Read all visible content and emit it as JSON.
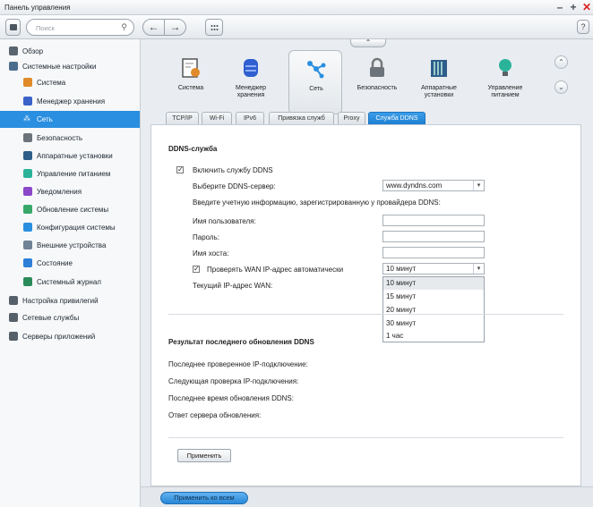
{
  "window": {
    "title": "Панель управления"
  },
  "toolbar": {
    "search_placeholder": "Поиск",
    "help_label": "?"
  },
  "sidebar": {
    "items": [
      {
        "label": "Обзор",
        "level": "top",
        "icon": "overview-icon",
        "color": "#5b6570"
      },
      {
        "label": "Системные настройки",
        "level": "top",
        "icon": "gear-icon",
        "color": "#4c6e8c"
      },
      {
        "label": "Система",
        "level": "sub",
        "icon": "system-icon",
        "color": "#e08a2a"
      },
      {
        "label": "Менеджер хранения",
        "level": "sub",
        "icon": "storage-icon",
        "color": "#3a62c8"
      },
      {
        "label": "Сеть",
        "level": "sub",
        "icon": "network-icon",
        "color": "#ffffff",
        "selected": true
      },
      {
        "label": "Безопасность",
        "level": "sub",
        "icon": "lock-icon",
        "color": "#6d737a"
      },
      {
        "label": "Аппаратные установки",
        "level": "sub",
        "icon": "hardware-icon",
        "color": "#2e5e8a"
      },
      {
        "label": "Управление питанием",
        "level": "sub",
        "icon": "bulb-icon",
        "color": "#2bb39a"
      },
      {
        "label": "Уведомления",
        "level": "sub",
        "icon": "notification-icon",
        "color": "#8a48c8"
      },
      {
        "label": "Обновление системы",
        "level": "sub",
        "icon": "update-icon",
        "color": "#38a86a"
      },
      {
        "label": "Конфигурация системы",
        "level": "sub",
        "icon": "config-icon",
        "color": "#2a8fe0"
      },
      {
        "label": "Внешние устройства",
        "level": "sub",
        "icon": "external-device-icon",
        "color": "#6f8296"
      },
      {
        "label": "Состояние",
        "level": "sub",
        "icon": "status-icon",
        "color": "#2e7fd8"
      },
      {
        "label": "Системный журнал",
        "level": "sub",
        "icon": "log-icon",
        "color": "#2b8a5a"
      },
      {
        "label": "Настройка привилегий",
        "level": "top",
        "icon": "user-icon",
        "color": "#56606a"
      },
      {
        "label": "Сетевые службы",
        "level": "top",
        "icon": "globe-icon",
        "color": "#56606a"
      },
      {
        "label": "Серверы приложений",
        "level": "top",
        "icon": "server-icon",
        "color": "#56606a"
      }
    ]
  },
  "apps": [
    {
      "label": "Система",
      "icon": "system-icon"
    },
    {
      "label": "Менеджер хранения",
      "icon": "storage-icon"
    },
    {
      "label": "Сеть",
      "icon": "network-icon",
      "active": true
    },
    {
      "label": "Безопасность",
      "icon": "lock-icon"
    },
    {
      "label": "Аппаратные установки",
      "icon": "hardware-icon"
    },
    {
      "label": "Управление питанием",
      "icon": "bulb-icon"
    }
  ],
  "tabs": [
    {
      "label": "TCP/IP"
    },
    {
      "label": "Wi-Fi"
    },
    {
      "label": "IPv6"
    },
    {
      "label": "Привязка служб"
    },
    {
      "label": "Proxy"
    },
    {
      "label": "Служба DDNS",
      "active": true
    }
  ],
  "ddns": {
    "section_title": "DDNS-служба",
    "enable_label": "Включить службу DDNS",
    "enable_checked": true,
    "server_label": "Выберите DDNS-сервер:",
    "server_value": "www.dyndns.com",
    "account_hint": "Введите учетную информацию, зарегистрированную у провайдера DDNS:",
    "username_label": "Имя пользователя:",
    "password_label": "Пароль:",
    "hostname_label": "Имя хоста:",
    "check_wan_label": "Проверять WAN IP-адрес автоматически",
    "check_wan_checked": true,
    "check_interval_value": "10 минут",
    "interval_options": [
      "10 минут",
      "15 минут",
      "20 минут",
      "30 минут",
      "1 час"
    ],
    "current_ip_label": "Текущий IP-адрес WAN:"
  },
  "result": {
    "title": "Результат последнего обновления DDNS",
    "last_checked_label": "Последнее проверенное IP-подключение:",
    "next_check_label": "Следующая проверка IP-подключения:",
    "last_update_label": "Последнее время обновления DDNS:",
    "server_response_label": "Ответ сервера обновления:"
  },
  "buttons": {
    "apply": "Применить",
    "apply_all": "Применить ко всем"
  },
  "colors": {
    "accent": "#2a8fe0",
    "close": "#dd2222"
  }
}
